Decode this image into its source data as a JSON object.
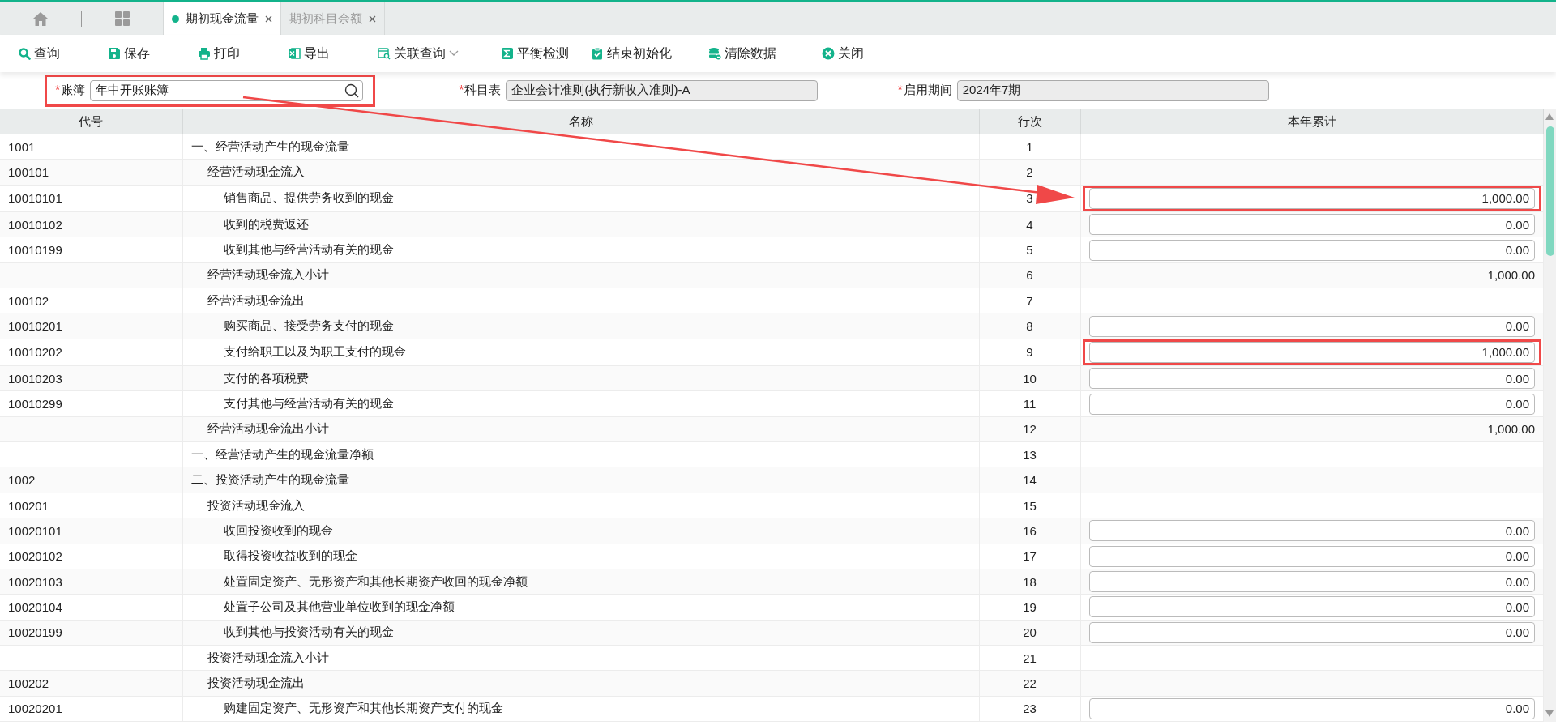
{
  "tabs": [
    {
      "label": "期初现金流量",
      "selected": true
    },
    {
      "label": "期初科目余额",
      "selected": false
    }
  ],
  "toolbar": [
    {
      "label": "查询",
      "dropdown": false
    },
    {
      "label": "保存",
      "dropdown": false
    },
    {
      "label": "打印",
      "dropdown": false
    },
    {
      "label": "导出",
      "dropdown": false
    },
    {
      "label": "关联查询",
      "dropdown": true
    },
    {
      "label": "平衡检测",
      "dropdown": false
    },
    {
      "label": "结束初始化",
      "dropdown": false
    },
    {
      "label": "清除数据",
      "dropdown": false
    },
    {
      "label": "关闭",
      "dropdown": false
    }
  ],
  "filters": [
    {
      "required_mark": "*",
      "label": "账簿",
      "value": "年中开账账簿",
      "disabled": false,
      "searchable": true,
      "highlighted": true
    },
    {
      "required_mark": "*",
      "label": "科目表",
      "value": "企业会计准则(执行新收入准则)-A",
      "disabled": true,
      "searchable": false,
      "highlighted": false
    },
    {
      "required_mark": "*",
      "label": "启用期间",
      "value": "2024年7期",
      "disabled": true,
      "searchable": false,
      "highlighted": false
    }
  ],
  "table": {
    "columns": [
      "代号",
      "名称",
      "行次",
      "本年累计"
    ],
    "rows": [
      {
        "code": "1001",
        "name": "一、经营活动产生的现金流量",
        "line": "1",
        "children": [
          {
            "code": "100101",
            "name": "经营活动现金流入",
            "line": "2",
            "children": [
              {
                "code": "10010101",
                "name": "销售商品、提供劳务收到的现金",
                "line": "3",
                "kind": "input",
                "value": "1,000.00",
                "highlighted": true
              },
              {
                "code": "10010102",
                "name": "收到的税费返还",
                "line": "4",
                "kind": "input",
                "value": "0.00",
                "highlighted": false
              },
              {
                "code": "10010199",
                "name": "收到其他与经营活动有关的现金",
                "line": "5",
                "kind": "input",
                "value": "0.00",
                "highlighted": false
              }
            ]
          },
          {
            "name": "经营活动现金流入小计",
            "line": "6",
            "kind": "total",
            "value": "1,000.00"
          },
          {
            "code": "100102",
            "name": "经营活动现金流出",
            "line": "7",
            "children": [
              {
                "code": "10010201",
                "name": "购买商品、接受劳务支付的现金",
                "line": "8",
                "kind": "input",
                "value": "0.00",
                "highlighted": false
              },
              {
                "code": "10010202",
                "name": "支付给职工以及为职工支付的现金",
                "line": "9",
                "kind": "input",
                "value": "1,000.00",
                "highlighted": true
              },
              {
                "code": "10010203",
                "name": "支付的各项税费",
                "line": "10",
                "kind": "input",
                "value": "0.00",
                "highlighted": false
              },
              {
                "code": "10010299",
                "name": "支付其他与经营活动有关的现金",
                "line": "11",
                "kind": "input",
                "value": "0.00",
                "highlighted": false
              }
            ]
          },
          {
            "name": "经营活动现金流出小计",
            "line": "12",
            "kind": "total",
            "value": "1,000.00"
          }
        ]
      },
      {
        "name": "一、经营活动产生的现金流量净额",
        "line": "13"
      },
      {
        "code": "1002",
        "name": "二、投资活动产生的现金流量",
        "line": "14",
        "children": [
          {
            "code": "100201",
            "name": "投资活动现金流入",
            "line": "15",
            "children": [
              {
                "code": "10020101",
                "name": "收回投资收到的现金",
                "line": "16",
                "kind": "input",
                "value": "0.00",
                "highlighted": false
              },
              {
                "code": "10020102",
                "name": "取得投资收益收到的现金",
                "line": "17",
                "kind": "input",
                "value": "0.00",
                "highlighted": false
              },
              {
                "code": "10020103",
                "name": "处置固定资产、无形资产和其他长期资产收回的现金净额",
                "line": "18",
                "kind": "input",
                "value": "0.00",
                "highlighted": false
              },
              {
                "code": "10020104",
                "name": "处置子公司及其他营业单位收到的现金净额",
                "line": "19",
                "kind": "input",
                "value": "0.00",
                "highlighted": false
              },
              {
                "code": "10020199",
                "name": "收到其他与投资活动有关的现金",
                "line": "20",
                "kind": "input",
                "value": "0.00",
                "highlighted": false
              }
            ]
          },
          {
            "name": "投资活动现金流入小计",
            "line": "21"
          },
          {
            "code": "100202",
            "name": "投资活动现金流出",
            "line": "22",
            "children": [
              {
                "code": "10020201",
                "name": "购建固定资产、无形资产和其他长期资产支付的现金",
                "line": "23",
                "kind": "input",
                "value": "0.00",
                "highlighted": false
              }
            ]
          }
        ]
      }
    ]
  }
}
